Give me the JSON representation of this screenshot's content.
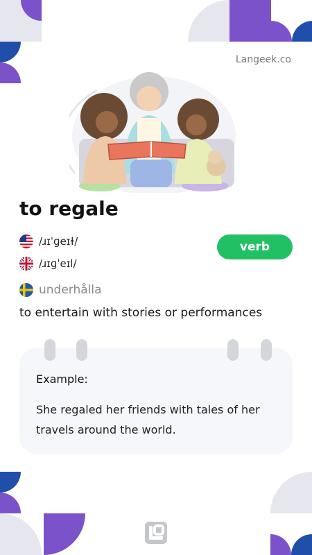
{
  "brand": "Langeek.co",
  "word": "to regale",
  "pronunciations": {
    "us": {
      "flag_icon": "us-flag-icon",
      "ipa": "/ɹɪˈɡeɪɫ/"
    },
    "uk": {
      "flag_icon": "uk-flag-icon",
      "ipa": "/ɹɪɡˈeɪl/"
    }
  },
  "part_of_speech": "verb",
  "translation": {
    "flag_icon": "sweden-flag-icon",
    "text": "underhålla"
  },
  "definition": "to entertain with stories or performances",
  "example": {
    "title": "Example:",
    "sentence": "She regaled her friends with tales of her travels around the world."
  },
  "colors": {
    "accent_purple": "#7b52c9",
    "accent_blue": "#1f4fa8",
    "deco_gray": "#e6e7ee",
    "verb_green": "#22c064",
    "card_bg": "#f6f7fb"
  },
  "icons": {
    "illustration": "grandmother-reading-book-illustration",
    "footer_logo": "langeek-logo-icon"
  }
}
